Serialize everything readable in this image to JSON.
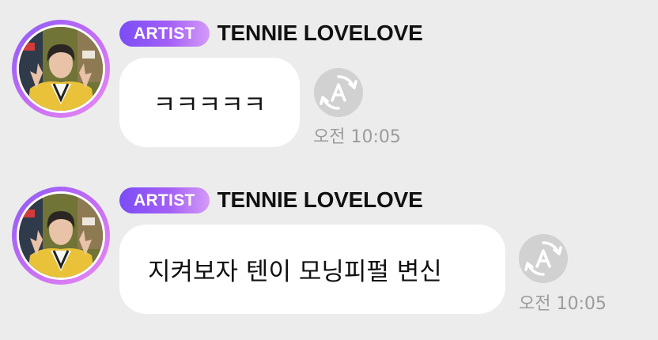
{
  "messages": [
    {
      "badge": "ARTIST",
      "author": "TENNIE LOVELOVE",
      "text": "ㅋㅋㅋㅋㅋ",
      "time": "오전 10:05",
      "translate_icon": "auto-translate-icon"
    },
    {
      "badge": "ARTIST",
      "author": "TENNIE LOVELOVE",
      "text": "지켜보자 텐이 모닝피펄 변신",
      "time": "오전 10:05",
      "translate_icon": "auto-translate-icon"
    }
  ],
  "colors": {
    "background": "#ececec",
    "bubble": "#ffffff",
    "badge_start": "#7a4df5",
    "badge_end": "#d49af7",
    "avatar_ring_start": "#8a5cf6",
    "avatar_ring_end": "#e88cf2",
    "translate_icon_bg": "#d1d1d1",
    "timestamp": "#9b9b9b"
  }
}
